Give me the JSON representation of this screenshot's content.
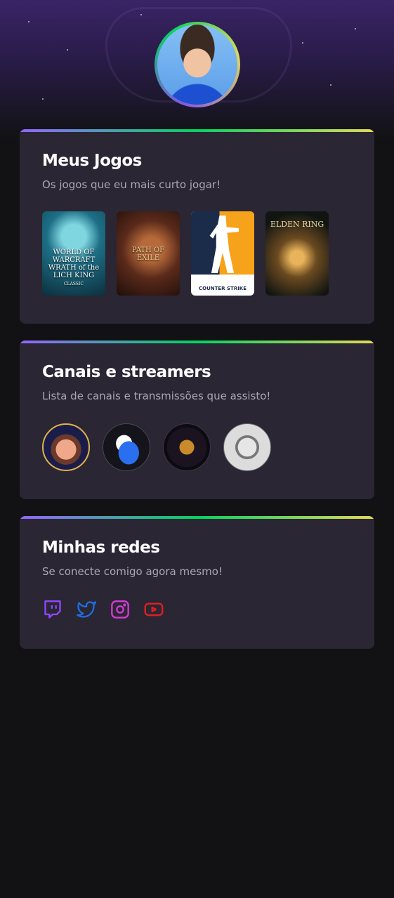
{
  "profile": {
    "avatar_alt": "profile-avatar"
  },
  "sections": {
    "games": {
      "title": "Meus Jogos",
      "subtitle": "Os jogos que eu mais curto jogar!",
      "items": [
        {
          "name": "World of Warcraft: Wrath of the Lich King Classic",
          "cover_text": "WORLD OF WARCRAFT WRATH OF THE LICH KING CLASSIC"
        },
        {
          "name": "Path of Exile",
          "cover_text": "PATH OF EXILE"
        },
        {
          "name": "Counter-Strike",
          "cover_text": "COUNTER STRIKE"
        },
        {
          "name": "Elden Ring",
          "cover_text": "ELDEN RING"
        }
      ]
    },
    "streamers": {
      "title": "Canais e streamers",
      "subtitle": "Lista de canais e transmissões que assisto!",
      "items": [
        {
          "icon": "cartoon-streamer-avatar"
        },
        {
          "icon": "winged-shoe-avatar"
        },
        {
          "icon": "letter-v-emblem-avatar"
        },
        {
          "icon": "white-tiger-avatar"
        }
      ]
    },
    "social": {
      "title": "Minhas redes",
      "subtitle": "Se conecte comigo agora mesmo!",
      "items": [
        {
          "icon": "twitch-icon",
          "color": "#9147ff"
        },
        {
          "icon": "twitter-icon",
          "color": "#1d6fe0"
        },
        {
          "icon": "instagram-icon",
          "color": "#d63ad6"
        },
        {
          "icon": "youtube-icon",
          "color": "#e02020"
        }
      ]
    }
  },
  "colors": {
    "background": "#121214",
    "card": "#2a2634",
    "accent_gradient": [
      "#9466ff",
      "#04d361",
      "#e1d95a"
    ],
    "title": "#ffffff",
    "subtitle": "#a8a8b3"
  }
}
